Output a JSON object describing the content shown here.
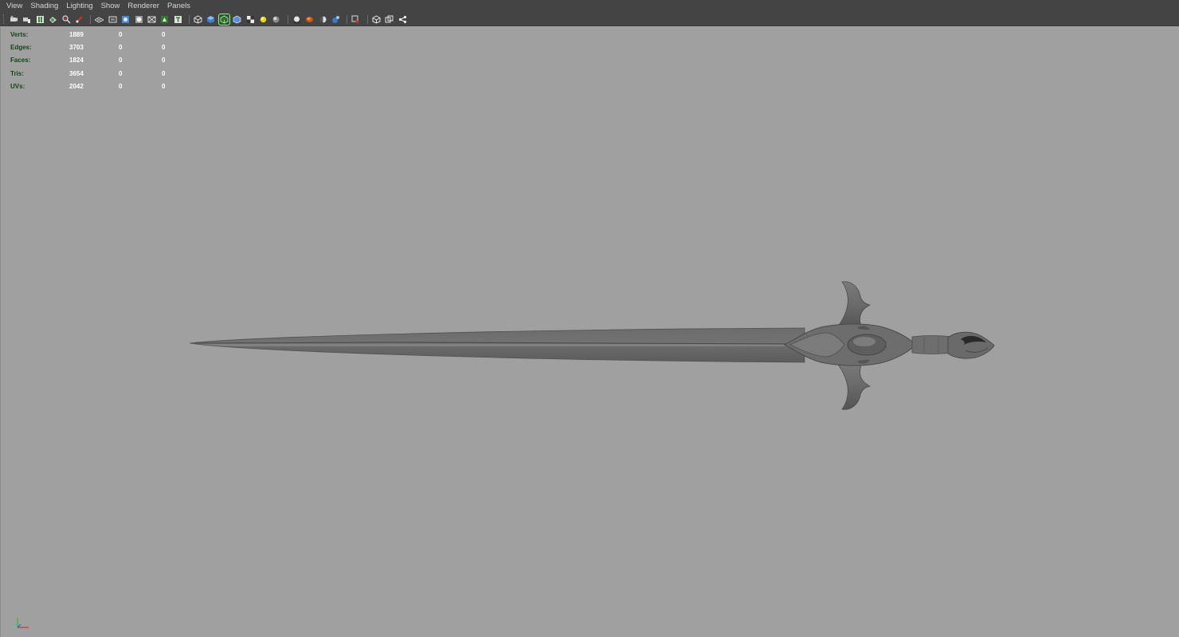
{
  "menu": {
    "items": [
      "View",
      "Shading",
      "Lighting",
      "Show",
      "Renderer",
      "Panels"
    ]
  },
  "toolbar": {
    "icons": [
      "camera-select-icon",
      "camera-attributes-icon",
      "bookmark-icon",
      "image-plane-icon",
      "2d-pan-zoom-icon",
      "grease-pencil-icon",
      "grid-icon",
      "film-gate-icon",
      "resolution-gate-icon",
      "gate-mask-icon",
      "field-chart-icon",
      "safe-title-icon",
      "wireframe-icon",
      "smooth-shade-icon",
      "wireframe-on-shaded-icon",
      "default-material-icon",
      "textured-icon",
      "use-all-lights-icon",
      "shadows-icon",
      "screen-space-ao-icon",
      "motion-blur-icon",
      "multisample-aa-icon",
      "depth-of-field-icon",
      "isolate-select-icon",
      "xray-icon",
      "xray-active-components-icon",
      "xray-joints-icon"
    ]
  },
  "hud": {
    "rows": [
      {
        "label": "Verts:",
        "v1": "1889",
        "v2": "0",
        "v3": "0"
      },
      {
        "label": "Edges:",
        "v1": "3703",
        "v2": "0",
        "v3": "0"
      },
      {
        "label": "Faces:",
        "v1": "1824",
        "v2": "0",
        "v3": "0"
      },
      {
        "label": "Tris:",
        "v1": "3654",
        "v2": "0",
        "v3": "0"
      },
      {
        "label": "UVs:",
        "v1": "2042",
        "v2": "0",
        "v3": "0"
      }
    ]
  },
  "colors": {
    "viewport_bg": "#a0a0a0",
    "menubar_bg": "#444444",
    "menu_text": "#d6d6d6",
    "hud_label": "#17431a",
    "hud_value": "#ffffff",
    "model": "#6f6f6f"
  }
}
